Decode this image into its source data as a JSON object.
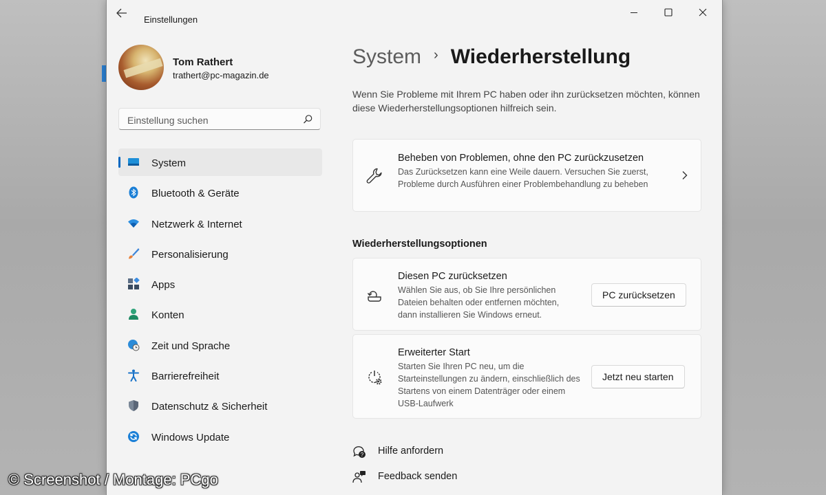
{
  "window": {
    "title": "Einstellungen"
  },
  "profile": {
    "name": "Tom Rathert",
    "email": "trathert@pc-magazin.de"
  },
  "search": {
    "placeholder": "Einstellung suchen"
  },
  "sidebar": {
    "items": [
      {
        "label": "System",
        "icon": "monitor-icon",
        "active": true
      },
      {
        "label": "Bluetooth & Geräte",
        "icon": "bluetooth-icon"
      },
      {
        "label": "Netzwerk & Internet",
        "icon": "wifi-icon"
      },
      {
        "label": "Personalisierung",
        "icon": "brush-icon"
      },
      {
        "label": "Apps",
        "icon": "apps-icon"
      },
      {
        "label": "Konten",
        "icon": "person-icon"
      },
      {
        "label": "Zeit und Sprache",
        "icon": "clock-globe-icon"
      },
      {
        "label": "Barrierefreiheit",
        "icon": "accessibility-icon"
      },
      {
        "label": "Datenschutz & Sicherheit",
        "icon": "shield-icon"
      },
      {
        "label": "Windows Update",
        "icon": "update-icon"
      }
    ]
  },
  "main": {
    "breadcrumb": {
      "parent": "System",
      "separator": "›",
      "current": "Wiederherstellung"
    },
    "intro": "Wenn Sie Probleme mit Ihrem PC haben oder ihn zurücksetzen möchten, können diese Wiederherstellungsoptionen hilfreich sein.",
    "fix_card": {
      "title": "Beheben von Problemen, ohne den PC zurückzusetzen",
      "desc": "Das Zurücksetzen kann eine Weile dauern. Versuchen Sie zuerst, Probleme durch Ausführen einer Problembehandlung zu beheben"
    },
    "section_title": "Wiederherstellungsoptionen",
    "reset_card": {
      "title": "Diesen PC zurücksetzen",
      "desc": "Wählen Sie aus, ob Sie Ihre persönlichen Dateien behalten oder entfernen möchten, dann installieren Sie Windows erneut.",
      "button": "PC zurücksetzen"
    },
    "advanced_card": {
      "title": "Erweiterter Start",
      "desc": "Starten Sie Ihren PC neu, um die Starteinstellungen zu ändern, einschließlich des Startens von einem Datenträger oder einem USB-Laufwerk",
      "button": "Jetzt neu starten"
    },
    "links": {
      "help": "Hilfe anfordern",
      "feedback": "Feedback senden"
    }
  },
  "watermark": "© Screenshot / Montage: PCgo",
  "colors": {
    "accent": "#0067c0",
    "background": "#f3f3f3",
    "card": "#fbfbfb"
  }
}
